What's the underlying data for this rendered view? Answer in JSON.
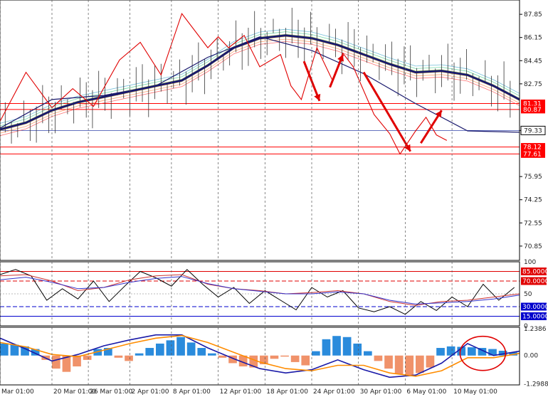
{
  "chart_data": [
    {
      "type": "line",
      "panel": "price",
      "ylim": [
        69.8,
        88.9
      ],
      "y_ticks": [
        "87.85",
        "86.15",
        "84.45",
        "82.75",
        "79.33",
        "75.95",
        "74.25",
        "72.55",
        "70.85"
      ],
      "y_tick_values": [
        87.85,
        86.15,
        84.45,
        82.75,
        79.33,
        75.95,
        74.25,
        72.55,
        70.85
      ],
      "current_price": "79.33",
      "levels": [
        {
          "label": "81.31",
          "value": 81.31,
          "color": "#ff0000"
        },
        {
          "label": "80.87",
          "value": 80.87,
          "color": "#ff0000"
        },
        {
          "label": "78.12",
          "value": 78.12,
          "color": "#ff0000"
        },
        {
          "label": "77.61",
          "value": 77.61,
          "color": "#ff0000"
        }
      ],
      "x_labels": [
        "Mar 01:00",
        "20 Mar 01:00",
        "26 Mar 01:00",
        "2 Apr 01:00",
        "8 Apr 01:00",
        "12 Apr 01:00",
        "18 Apr 01:00",
        "24 Apr 01:00",
        "30 Apr 01:00",
        "6 May 01:00",
        "10 May 01:00"
      ],
      "series": [
        {
          "name": "",
          "color": "#1a1a6e",
          "x": [
            0,
            5,
            10,
            15,
            20,
            25,
            30,
            35,
            40,
            45,
            50,
            55,
            60,
            65,
            70,
            75,
            80,
            85,
            90,
            95,
            100
          ],
          "values": [
            79.4,
            79.9,
            80.8,
            81.4,
            81.8,
            82.2,
            82.6,
            83.0,
            84.1,
            85.4,
            86.1,
            86.3,
            86.1,
            85.6,
            84.9,
            84.2,
            83.6,
            83.7,
            83.4,
            82.6,
            81.6
          ]
        },
        {
          "name": "",
          "color": "#1a1a6e",
          "x": [
            0,
            10,
            20,
            30,
            40,
            50,
            60,
            70,
            80,
            90,
            100
          ],
          "values": [
            79.5,
            81.6,
            81.9,
            82.6,
            84.7,
            86.2,
            85.2,
            83.5,
            81.3,
            79.3,
            79.2
          ]
        }
      ],
      "zigzag": {
        "color": "#e00000",
        "x": [
          0,
          5,
          10,
          14,
          18,
          23,
          27,
          31,
          35,
          40,
          42,
          44,
          47,
          50,
          54,
          56,
          58,
          61,
          64,
          66,
          68,
          72,
          75,
          77,
          80,
          82,
          84,
          86
        ],
        "values": [
          80.0,
          83.6,
          81.0,
          82.4,
          81.1,
          84.5,
          85.8,
          83.4,
          87.9,
          85.4,
          86.2,
          85.4,
          86.3,
          84.0,
          84.9,
          82.6,
          81.6,
          85.4,
          83.0,
          85.0,
          84.0,
          80.5,
          79.1,
          77.6,
          79.3,
          80.3,
          79.0,
          78.6
        ]
      },
      "arrows": [
        {
          "x": [
            58.5,
            61.5
          ],
          "values": [
            84.4,
            81.5
          ]
        },
        {
          "x": [
            63.5,
            66
          ],
          "values": [
            82.5,
            84.9
          ]
        },
        {
          "x": [
            70,
            79
          ],
          "values": [
            83.6,
            77.8
          ]
        },
        {
          "x": [
            81,
            85
          ],
          "values": [
            78.4,
            80.8
          ]
        }
      ]
    },
    {
      "type": "line",
      "panel": "oscillator",
      "ylim": [
        0,
        100
      ],
      "y_ticks": [
        "100",
        "85.0000",
        "70.0000",
        "50",
        "30.0000",
        "15.0000",
        "0"
      ],
      "levels": [
        {
          "label": "85.0000",
          "value": 85,
          "color": "#e00000"
        },
        {
          "label": "70.0000",
          "value": 70,
          "color": "#e00000"
        },
        {
          "label": "30.0000",
          "value": 30,
          "color": "#0000cc"
        },
        {
          "label": "15.0000",
          "value": 15,
          "color": "#0000cc"
        }
      ],
      "series": [
        {
          "name": "",
          "color": "#000000",
          "x": [
            0,
            3,
            6,
            9,
            12,
            15,
            18,
            21,
            24,
            27,
            30,
            33,
            36,
            39,
            42,
            45,
            48,
            51,
            54,
            57,
            60,
            63,
            66,
            69,
            72,
            75,
            78,
            81,
            84,
            87,
            90,
            93,
            96,
            99
          ],
          "values": [
            80,
            88,
            78,
            40,
            58,
            42,
            70,
            38,
            62,
            85,
            75,
            62,
            88,
            65,
            45,
            60,
            35,
            55,
            40,
            25,
            60,
            45,
            55,
            28,
            22,
            30,
            18,
            38,
            24,
            45,
            30,
            65,
            40,
            60
          ]
        },
        {
          "name": "",
          "color": "#cc3333",
          "x": [
            0,
            5,
            10,
            15,
            20,
            25,
            30,
            35,
            40,
            45,
            50,
            55,
            60,
            65,
            70,
            75,
            80,
            85,
            90,
            95,
            100
          ],
          "values": [
            78,
            80,
            70,
            55,
            60,
            72,
            78,
            80,
            65,
            58,
            55,
            50,
            52,
            55,
            50,
            38,
            32,
            38,
            40,
            45,
            50
          ]
        },
        {
          "name": "",
          "color": "#3333cc",
          "x": [
            0,
            5,
            10,
            15,
            20,
            25,
            30,
            35,
            40,
            45,
            50,
            55,
            60,
            65,
            70,
            75,
            80,
            85,
            90,
            95,
            100
          ],
          "values": [
            72,
            76,
            68,
            58,
            60,
            68,
            74,
            77,
            66,
            58,
            54,
            50,
            50,
            53,
            50,
            40,
            34,
            36,
            38,
            42,
            48
          ]
        }
      ]
    },
    {
      "type": "bar",
      "panel": "macd",
      "ylim": [
        -1.35,
        1.3
      ],
      "y_ticks": [
        "1.2386",
        "0.00",
        "-1.2988"
      ],
      "histogram": {
        "pos_color": "#2a8bdc",
        "neg_color": "#f0926a",
        "x": [
          0,
          2,
          4,
          6,
          8,
          10,
          12,
          14,
          16,
          18,
          20,
          22,
          24,
          26,
          28,
          30,
          32,
          34,
          36,
          38,
          40,
          42,
          44,
          46,
          48,
          50,
          52,
          54,
          56,
          58,
          60,
          62,
          64,
          66,
          68,
          70,
          72,
          74,
          76,
          78,
          80,
          82,
          84,
          86,
          88,
          90,
          92,
          94,
          96,
          98
        ],
        "values": [
          0.55,
          0.5,
          0.42,
          0.3,
          -0.2,
          -0.6,
          -0.75,
          -0.5,
          -0.2,
          0.3,
          0.35,
          -0.1,
          -0.25,
          0.1,
          0.35,
          0.55,
          0.7,
          0.85,
          0.6,
          0.35,
          0.1,
          -0.1,
          -0.35,
          -0.5,
          -0.55,
          -0.4,
          -0.15,
          -0.05,
          -0.3,
          -0.45,
          0.2,
          0.75,
          0.9,
          0.85,
          0.55,
          0.2,
          -0.25,
          -0.6,
          -0.85,
          -0.95,
          -0.8,
          -0.55,
          0.35,
          0.42,
          0.4,
          0.38,
          0.35,
          0.3,
          0.22,
          0.15
        ]
      },
      "series": [
        {
          "name": "",
          "color": "#1a1aa8",
          "x": [
            0,
            5,
            10,
            15,
            20,
            25,
            30,
            35,
            40,
            45,
            50,
            55,
            60,
            65,
            70,
            75,
            80,
            85,
            90,
            95,
            100
          ],
          "values": [
            0.8,
            0.3,
            -0.25,
            0.05,
            0.45,
            0.72,
            0.95,
            0.95,
            0.35,
            -0.15,
            -0.6,
            -0.8,
            -0.65,
            -0.2,
            -0.65,
            -1.0,
            -0.9,
            -0.35,
            0.55,
            0.0,
            0.2
          ]
        },
        {
          "name": "",
          "color": "#ff8c00",
          "x": [
            0,
            5,
            10,
            15,
            20,
            25,
            30,
            35,
            40,
            45,
            50,
            55,
            60,
            65,
            70,
            75,
            80,
            85,
            90,
            95,
            100
          ],
          "values": [
            0.6,
            0.4,
            0.05,
            -0.05,
            0.25,
            0.55,
            0.8,
            0.92,
            0.6,
            0.15,
            -0.3,
            -0.6,
            -0.7,
            -0.45,
            -0.45,
            -0.8,
            -0.95,
            -0.7,
            -0.1,
            -0.1,
            0.1
          ]
        }
      ],
      "annotation": {
        "type": "circle",
        "color": "#e00000",
        "x": 98,
        "y": 0.1
      }
    }
  ]
}
